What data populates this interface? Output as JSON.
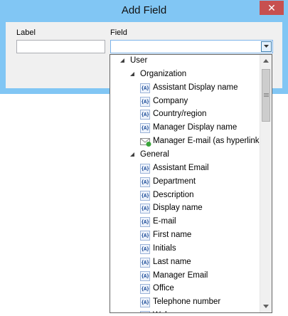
{
  "window": {
    "title": "Add Field",
    "close_glyph": "✕"
  },
  "form": {
    "label_caption": "Label",
    "field_caption": "Field",
    "label_value": "",
    "field_value": ""
  },
  "tree": {
    "root": "User",
    "groups": [
      {
        "label": "Organization",
        "items": [
          {
            "label": "Assistant Display name",
            "icon": "field-icon"
          },
          {
            "label": "Company",
            "icon": "field-icon"
          },
          {
            "label": "Country/region",
            "icon": "field-icon"
          },
          {
            "label": "Manager Display name",
            "icon": "field-icon"
          },
          {
            "label": "Manager E-mail (as hyperlink)",
            "icon": "email-link-icon"
          }
        ]
      },
      {
        "label": "General",
        "items": [
          {
            "label": "Assistant Email",
            "icon": "field-icon"
          },
          {
            "label": "Department",
            "icon": "field-icon"
          },
          {
            "label": "Description",
            "icon": "field-icon"
          },
          {
            "label": "Display name",
            "icon": "field-icon"
          },
          {
            "label": "E-mail",
            "icon": "field-icon"
          },
          {
            "label": "First name",
            "icon": "field-icon"
          },
          {
            "label": "Initials",
            "icon": "field-icon"
          },
          {
            "label": "Last name",
            "icon": "field-icon"
          },
          {
            "label": "Manager Email",
            "icon": "field-icon"
          },
          {
            "label": "Office",
            "icon": "field-icon"
          },
          {
            "label": "Telephone number",
            "icon": "field-icon"
          },
          {
            "label": "Web page",
            "icon": "field-icon"
          }
        ]
      }
    ]
  },
  "colors": {
    "frame": "#81c6f4",
    "close": "#c75050",
    "icon": "#1f4f9a"
  }
}
